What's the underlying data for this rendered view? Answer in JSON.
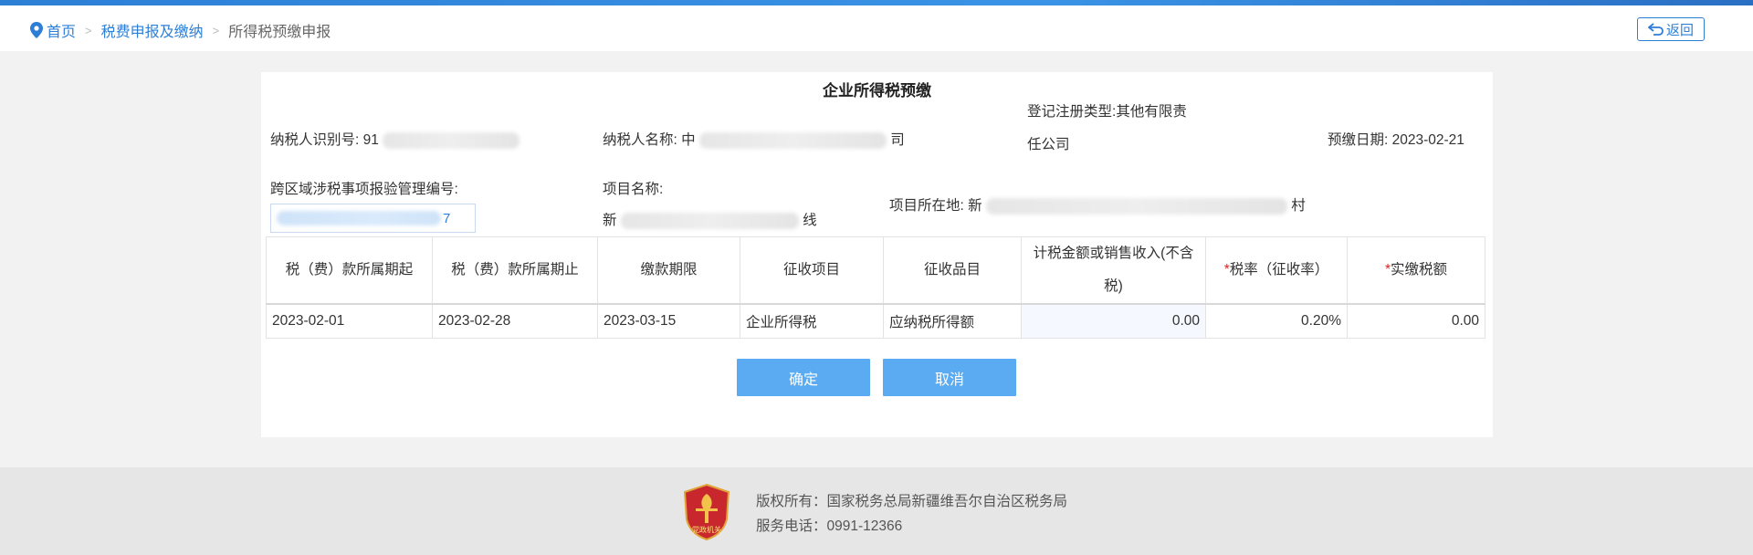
{
  "breadcrumb": {
    "home": "首页",
    "level2": "税费申报及缴纳",
    "current": "所得税预缴申报",
    "separator": ">"
  },
  "header": {
    "back_label": "返回"
  },
  "form": {
    "title": "企业所得税预缴",
    "taxpayer_id_label": "纳税人识别号:",
    "taxpayer_id_prefix": "91",
    "taxpayer_name_label": "纳税人名称:",
    "taxpayer_name_prefix": "中",
    "taxpayer_name_suffix": "司",
    "reg_type_label": "登记注册类型:",
    "reg_type_value_1": "其他有限责",
    "reg_type_value_2": "任公司",
    "prepay_date_label": "预缴日期:",
    "prepay_date_value": "2023-02-21",
    "cross_region_label": "跨区域涉税事项报验管理编号:",
    "cross_region_tail": "7",
    "project_name_label": "项目名称:",
    "project_name_prefix": "新",
    "project_name_suffix": "线",
    "project_location_label": "项目所在地:",
    "project_location_prefix": "新",
    "project_location_suffix": "村"
  },
  "table": {
    "headers": {
      "period_start": "税（费）款所属期起",
      "period_end": "税（费）款所属期止",
      "due_date": "缴款期限",
      "levy_item": "征收项目",
      "levy_subitem": "征收品目",
      "taxable_amount": "计税金额或销售收入(不含税)",
      "tax_rate": "税率（征收率）",
      "actual_tax": "实缴税额",
      "required_mark": "*"
    },
    "row": {
      "period_start": "2023-02-01",
      "period_end": "2023-02-28",
      "due_date": "2023-03-15",
      "levy_item": "企业所得税",
      "levy_subitem": "应纳税所得额",
      "taxable_amount": "0.00",
      "tax_rate": "0.20%",
      "actual_tax": "0.00"
    }
  },
  "actions": {
    "confirm_label": "确定",
    "cancel_label": "取消"
  },
  "footer": {
    "copyright": "版权所有：国家税务总局新疆维吾尔自治区税务局",
    "phone": "服务电话：0991-12366",
    "logo_text": "党政机关"
  },
  "colors": {
    "accent": "#2d7fd6",
    "button": "#5aabf2",
    "required": "#e02020",
    "logo_red": "#c8282d"
  },
  "icons": {
    "location": "location-pin-icon",
    "back": "back-arrow-icon",
    "logo": "government-emblem-icon"
  }
}
